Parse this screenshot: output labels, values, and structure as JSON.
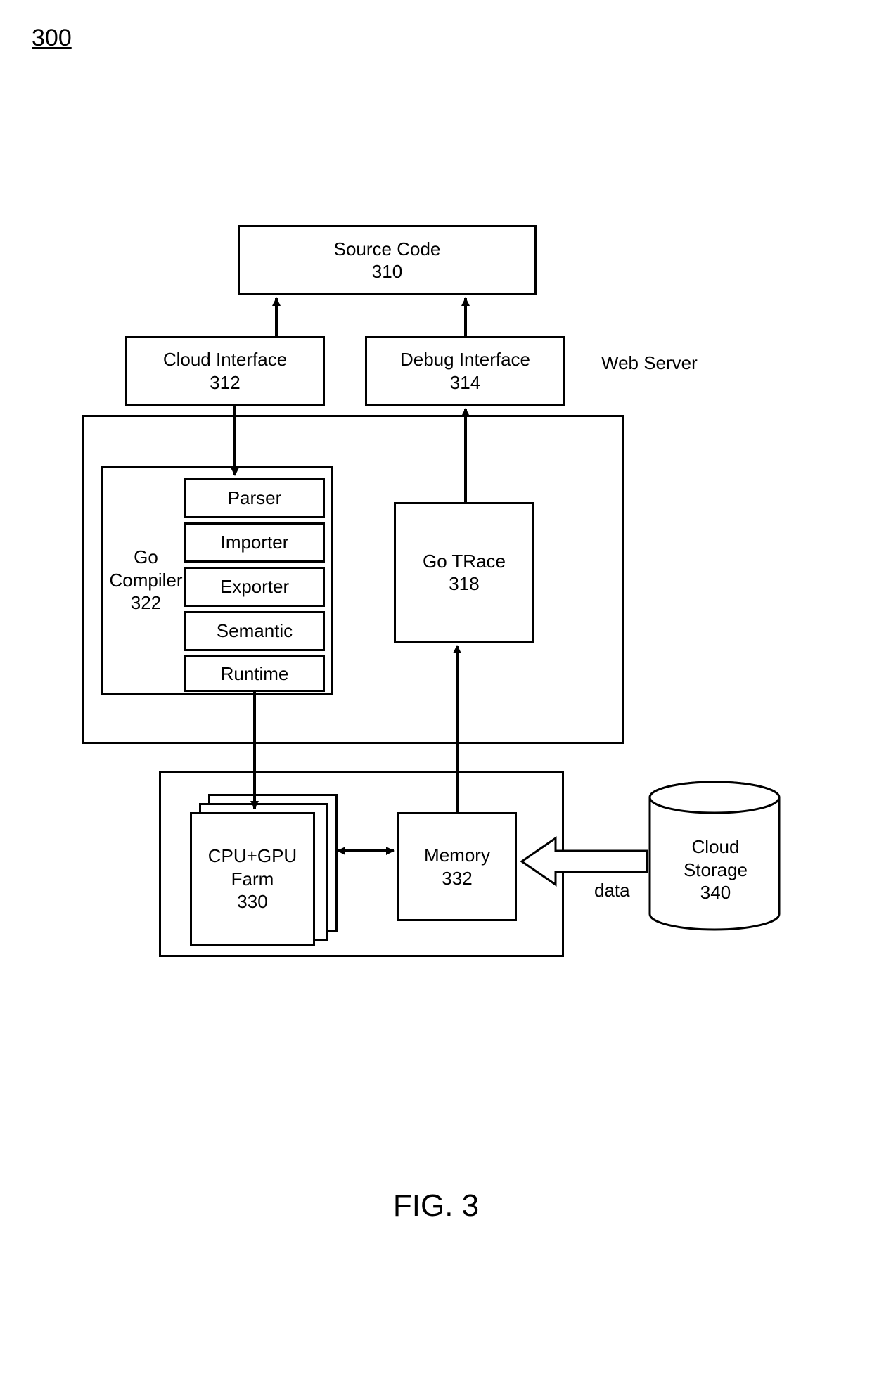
{
  "figure_number": "300",
  "figure_title": "FIG. 3",
  "boxes": {
    "source_code": {
      "title": "Source Code",
      "num": "310"
    },
    "cloud_interface": {
      "title": "Cloud Interface",
      "num": "312"
    },
    "debug_interface": {
      "title": "Debug Interface",
      "num": "314"
    },
    "go_compiler": {
      "title": "Go Compiler",
      "num": "322"
    },
    "go_trace": {
      "title": "Go TRace",
      "num": "318"
    },
    "cpu_gpu_farm": {
      "title": "CPU+GPU Farm",
      "num": "330"
    },
    "memory": {
      "title": "Memory",
      "num": "332"
    },
    "cloud_storage": {
      "title": "Cloud Storage",
      "num": "340"
    }
  },
  "compiler_stages": {
    "parser": "Parser",
    "importer": "Importer",
    "exporter": "Exporter",
    "semantic": "Semantic",
    "runtime": "Runtime"
  },
  "labels": {
    "web_server": "Web Server",
    "data": "data"
  }
}
